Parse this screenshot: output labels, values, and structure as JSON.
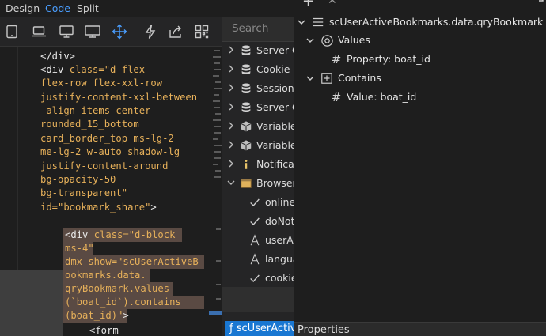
{
  "menubar": {
    "design": "Design",
    "code": "Code",
    "split": "Split"
  },
  "accent": "#1977d2",
  "toolbar": {
    "icons": [
      "mobile-device-icon",
      "laptop-icon",
      "desktop-icon",
      "wide-monitor-icon",
      "move-icon",
      "lightning-icon",
      "share-icon",
      "qr-code-icon"
    ]
  },
  "code": {
    "l1": "</div>",
    "l2a": "<div ",
    "l2b": "class=",
    "l2c": "\"d-flex",
    "l3": "flex-row flex-xxl-row",
    "l4": "justify-content-xxl-between",
    "l5": " align-items-center",
    "l6": "rounded_15_bottom",
    "l7": "card_border_top ms-lg-2",
    "l8": "me-lg-2 w-auto shadow-lg",
    "l9": "justify-content-around",
    "l10": "bg-opacity-50",
    "l11": "bg-transparent\"",
    "l12a": "id=",
    "l12b": "\"bookmark_share\"",
    "l12c": ">",
    "l13a": "<div ",
    "l13b": "class=",
    "l13c": "\"d-block",
    "l14": "ms-4\"",
    "l15a": "dmx-show=",
    "l15b": "\"scUserActiveB",
    "l16": "ookmarks.data.",
    "l17": "qryBookmark.values",
    "l18": "(`boat_id`).contains",
    "l19a": "(boat_id)\"",
    "l19b": ">",
    "l20": "<form"
  },
  "middle": {
    "search_placeholder": "Search",
    "items": [
      {
        "label": "Server Co",
        "icon": "database-icon"
      },
      {
        "label": "Cookie M",
        "icon": "database-icon"
      },
      {
        "label": "Session S",
        "icon": "database-icon"
      },
      {
        "label": "Server Co",
        "icon": "database-icon"
      },
      {
        "label": "Variable:",
        "icon": "cube-icon"
      },
      {
        "label": "Variable:",
        "icon": "cube-icon"
      },
      {
        "label": "Notificat",
        "icon": "info-icon"
      },
      {
        "label": "Browser:",
        "icon": "browser-window-icon"
      },
      {
        "label": "online",
        "icon": "check-icon"
      },
      {
        "label": "doNot",
        "icon": "check-icon"
      },
      {
        "label": "userAg",
        "icon": "text-a-icon"
      },
      {
        "label": "langua",
        "icon": "text-a-icon"
      },
      {
        "label": "cookie",
        "icon": "check-icon"
      }
    ],
    "active_tab": "ƒ scUserActive"
  },
  "panel": {
    "root": "scUserActiveBookmarks.data.qryBookmark",
    "values": "Values",
    "property": "Property: boat_id",
    "contains": "Contains",
    "value": "Value: boat_id",
    "properties_tab": "Properties"
  }
}
